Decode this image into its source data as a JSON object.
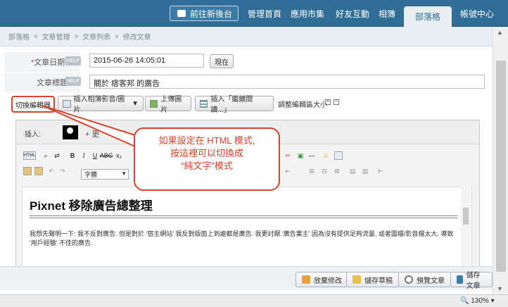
{
  "topnav": {
    "backend_button": "前往新後台",
    "links": [
      "管理首頁",
      "應用市集",
      "好友互動",
      "相簿"
    ],
    "active_tab": "部落格",
    "account": "帳號中心"
  },
  "breadcrumb": [
    "部落格",
    "文章管理",
    "文章列表",
    "修改文章"
  ],
  "form": {
    "date_label": "文章日期",
    "date_required": "*",
    "help": "HELP",
    "date_value": "2015-06-26 14:05:01",
    "now_button": "現在",
    "title_label": "文章標題",
    "title_value": "關於 痞客邦 的廣告"
  },
  "editor_toolbar": {
    "switch_editor": "切換編輯器",
    "insert_album": "插入相簿影音/圖片",
    "upload_image": "上傳圖片",
    "insert_continue": "插入「繼續閱讀...」",
    "adjust_size": "調整編輯區大小",
    "plus": "+",
    "minus": "−"
  },
  "editor": {
    "insert_label": "插入:",
    "insert_more": "+ 更",
    "font_select": "字體",
    "html_label": "HTML",
    "content_title": "Pixnet 移除廣告總整理",
    "content_body": "我想先聲明一下: 我不反對廣告. 但是對於 '宿主網站' 我反對版面上到處都是廣告. 我更討厭 '廣告業主' 因為沒有提供足夠流量, 或者圖檔/影音檔太大, 導致 '用戶經驗' 不佳的廣告."
  },
  "callout": {
    "line1": "如果設定在 HTML 模式,",
    "line2": "按這裡可以切換成",
    "line3": "“純文字”模式"
  },
  "actions": {
    "discard": "放棄修改",
    "save_draft": "儲存草稿",
    "preview": "預覽文章",
    "save": "儲存文章"
  },
  "status": {
    "zoom": "130%"
  },
  "colors": {
    "nav": "#2f6d96",
    "highlight": "#d9432c"
  }
}
